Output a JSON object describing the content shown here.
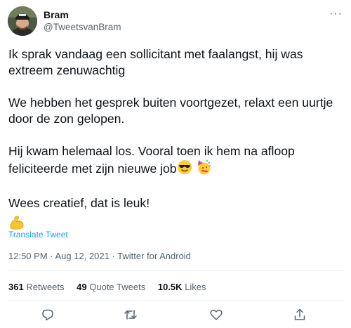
{
  "author": {
    "display_name": "Bram",
    "handle": "@TweetsvanBram"
  },
  "tweet": {
    "paragraphs": [
      "Ik sprak vandaag een sollicitant met faalangst, hij was extreem zenuwachtig",
      "We hebben het gesprek buiten voortgezet, relaxt een uurtje door de zon gelopen.",
      "Hij kwam helemaal los. Vooral toen ik hem na afloop feliciteerde met zijn nieuwe job",
      "Wees creatief, dat is leuk!"
    ],
    "translate_label": "Translate Tweet",
    "timestamp": "12:50 PM · Aug 12, 2021 · Twitter for Android"
  },
  "stats": {
    "retweets_count": "361",
    "retweets_label": "Retweets",
    "quotes_count": "49",
    "quotes_label": "Quote Tweets",
    "likes_count": "10.5K",
    "likes_label": "Likes"
  },
  "icons": {
    "more": "more-options-icon",
    "reply": "reply-icon",
    "retweet": "retweet-icon",
    "like": "like-icon",
    "share": "share-icon",
    "emoji_sunglasses": "sunglasses-emoji",
    "emoji_party": "party-face-emoji",
    "emoji_muscle": "flexed-biceps-emoji"
  },
  "colors": {
    "link": "#1d9bf0",
    "secondary_text": "#536471",
    "primary_text": "#0f1419"
  }
}
